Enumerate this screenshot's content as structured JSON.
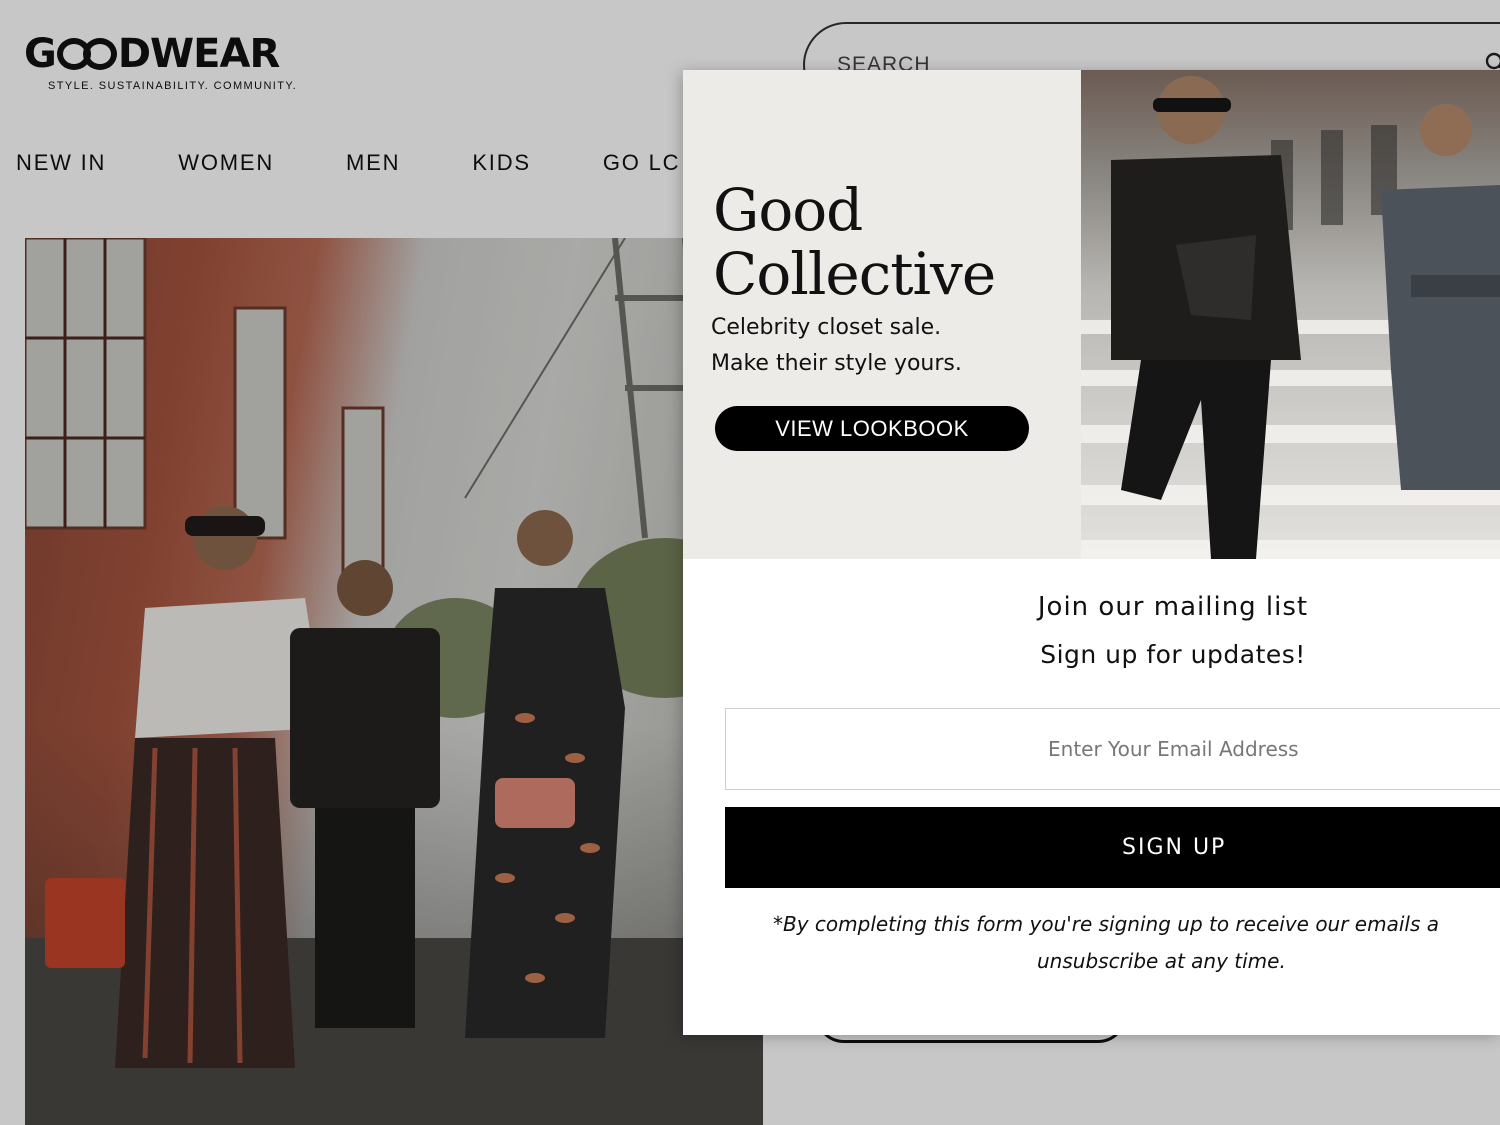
{
  "brand": {
    "name": "GOODWEAR",
    "name_pre": "G",
    "name_post": "DWEAR",
    "tagline": "STYLE. SUSTAINABILITY. COMMUNITY."
  },
  "search": {
    "placeholder": "SEARCH",
    "icon": "search-icon"
  },
  "nav": {
    "items": [
      "NEW IN",
      "WOMEN",
      "MEN",
      "KIDS",
      "GO LC"
    ]
  },
  "modal": {
    "promo": {
      "title_line1": "Good",
      "title_line2": "Collective",
      "sub_line1": "Celebrity closet sale.",
      "sub_line2": "Make their style yours.",
      "button_label": "VIEW LOOKBOOK"
    },
    "mailing": {
      "title": "Join our mailing list",
      "subtitle": "Sign up for updates!",
      "email_placeholder": "Enter Your Email Address",
      "signup_label": "SIGN UP",
      "disclaimer_line1": "*By completing this form you're signing up to receive our emails a",
      "disclaimer_line2": "unsubscribe at any time."
    }
  },
  "colors": {
    "accent": "#000000",
    "promo_bg": "#ecebe8",
    "page_dim": "#c9c9c7"
  }
}
